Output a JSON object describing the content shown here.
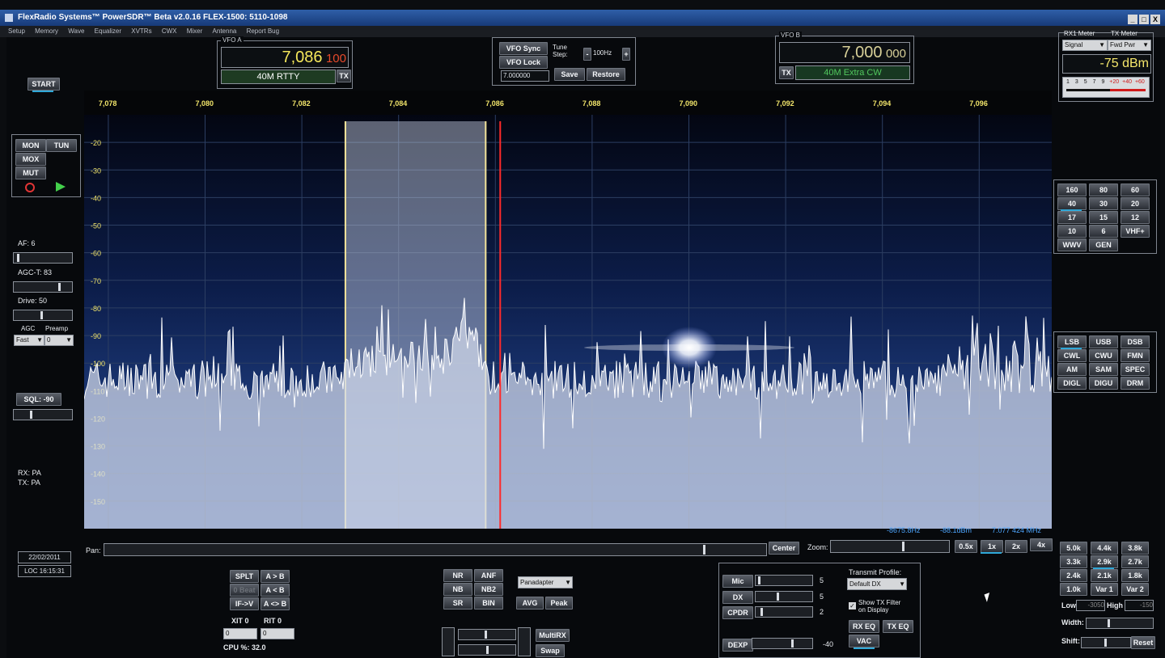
{
  "window": {
    "title": "FlexRadio Systems™ PowerSDR™ Beta  v2.0.16   FLEX-1500: 5110-1098",
    "buttons": [
      "_",
      "□",
      "X"
    ]
  },
  "menu": [
    "Setup",
    "Memory",
    "Wave",
    "Equalizer",
    "XVTRs",
    "CWX",
    "Mixer",
    "Antenna",
    "Report Bug"
  ],
  "vfo_a": {
    "title": "VFO A",
    "freq_main": "7,086",
    "freq_sub": "100",
    "band_label": "40M RTTY",
    "tx_label": "TX"
  },
  "vfo_b": {
    "title": "VFO B",
    "freq_main": "7,000",
    "freq_sub": "000",
    "band_label": "40M Extra CW",
    "tx_label": "TX"
  },
  "vfo_controls": {
    "sync": "VFO Sync",
    "lock": "VFO Lock",
    "tune_label": "Tune Step:",
    "tune_step": "100Hz",
    "minus": "-",
    "plus": "+",
    "mem_freq": "7.000000",
    "save": "Save",
    "restore": "Restore"
  },
  "meter": {
    "rx_title": "RX1 Meter",
    "tx_title": "TX Meter",
    "rx_mode": "Signal",
    "tx_mode": "Fwd Pwr",
    "reading": "-75 dBm",
    "scale": [
      "1",
      "3",
      "5",
      "7",
      "9",
      "+20",
      "+40",
      "+60"
    ]
  },
  "left_panel": {
    "start": "START",
    "mon": "MON",
    "tun": "TUN",
    "mox": "MOX",
    "mut": "MUT",
    "af": "AF:  6",
    "agct": "AGC-T:  83",
    "drive": "Drive:  50",
    "agc_label": "AGC",
    "preamp_label": "Preamp",
    "agc_value": "Fast",
    "preamp_value": "0",
    "sql": "SQL:  -90",
    "rx_pa": "RX: PA",
    "tx_pa": "TX: PA",
    "date": "22/02/2011",
    "time": "LOC 16:15:31"
  },
  "levels": {
    "af": 0.06,
    "agct": 0.83,
    "drive": 0.5,
    "sql": 0.3
  },
  "spectrum": {
    "freq_ticks": [
      "7,078",
      "7,080",
      "7,082",
      "7,084",
      "7,086",
      "7,088",
      "7,090",
      "7,092",
      "7,094",
      "7,096"
    ],
    "db_ticks": [
      "-20",
      "-30",
      "-40",
      "-50",
      "-60",
      "-70",
      "-80",
      "-90",
      "-100",
      "-110",
      "-120",
      "-130",
      "-140",
      "-150"
    ],
    "cursor_offset": "-8675.8Hz",
    "cursor_dbm": "-88.1dBm",
    "cursor_freq": "7.077 424 MHz",
    "filter_low": 7082.9,
    "filter_high": 7085.8,
    "carrier": 7086.1,
    "span_low": 7077.5,
    "span_high": 7097.5
  },
  "bands": [
    "160",
    "80",
    "60",
    "40",
    "30",
    "20",
    "17",
    "15",
    "12",
    "10",
    "6",
    "VHF+",
    "WWV",
    "GEN"
  ],
  "selected_band": "40",
  "modes": [
    "LSB",
    "USB",
    "DSB",
    "CWL",
    "CWU",
    "FMN",
    "AM",
    "SAM",
    "SPEC",
    "DIGL",
    "DIGU",
    "DRM"
  ],
  "selected_mode": "LSB",
  "pan_zoom": {
    "pan": "Pan:",
    "center": "Center",
    "zoom": "Zoom:",
    "zoom_options": [
      "0.5x",
      "1x",
      "2x",
      "4x"
    ],
    "selected_zoom": "1x"
  },
  "filters": [
    "5.0k",
    "4.4k",
    "3.8k",
    "3.3k",
    "2.9k",
    "2.7k",
    "2.4k",
    "2.1k",
    "1.8k",
    "1.0k",
    "Var 1",
    "Var 2"
  ],
  "selected_filter": "2.9k",
  "filter_controls": {
    "low_label": "Low",
    "low_value": "-3050",
    "high_label": "High",
    "high_value": "-150",
    "width": "Width:",
    "shift": "Shift:",
    "reset": "Reset"
  },
  "split_panel": {
    "splt": "SPLT",
    "a_to_b": "A > B",
    "zero_beat": "0 Beat",
    "b_to_a": "A < B",
    "if_v": "IF->V",
    "swap_ab": "A <> B",
    "xit": "XIT   0",
    "rit": "RIT   0",
    "xit_value": "0",
    "rit_value": "0",
    "cpu": "CPU %: 32.0"
  },
  "dsp_panel": {
    "nr": "NR",
    "anf": "ANF",
    "nb": "NB",
    "nb2": "NB2",
    "sr": "SR",
    "bin": "BIN",
    "display_mode": "Panadapter",
    "avg": "AVG",
    "peak": "Peak",
    "multirx": "MultiRX",
    "swap": "Swap"
  },
  "tx_panel": {
    "mic": "Mic",
    "mic_value": "5",
    "dx": "DX",
    "dx_value": "5",
    "cpdr": "CPDR",
    "cpdr_value": "2",
    "dexp": "DEXP",
    "dexp_value": "-40",
    "profile_label": "Transmit Profile:",
    "profile": "Default DX",
    "show_filter": "Show TX Filter on Display",
    "rx_eq": "RX EQ",
    "tx_eq": "TX EQ",
    "vac": "VAC"
  },
  "tx_levels": {
    "mic": 0.05,
    "dx": 0.4,
    "cpdr": 0.1,
    "dexp": 0.7
  }
}
